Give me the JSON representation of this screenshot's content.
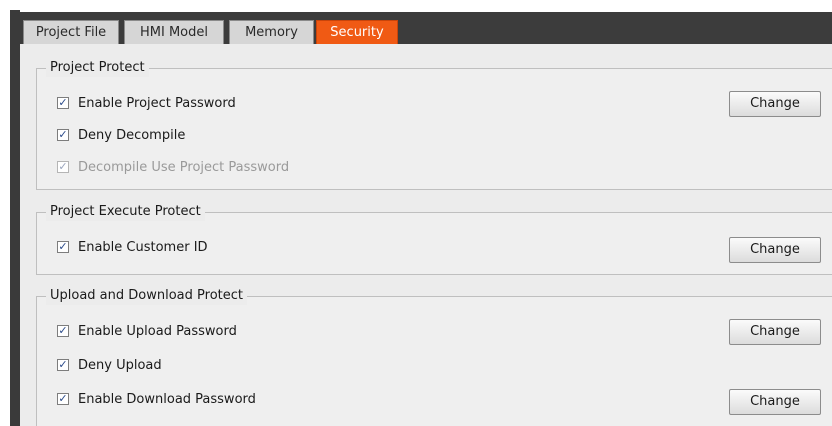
{
  "tabs": [
    {
      "label": "Project File"
    },
    {
      "label": "HMI Model"
    },
    {
      "label": "Memory"
    },
    {
      "label": "Security",
      "active": true
    }
  ],
  "colors": {
    "active_tab": "#f05a14",
    "tab_bar": "#3c3c3c",
    "panel": "#ececec"
  },
  "groups": {
    "project_protect": {
      "title": "Project Protect",
      "enable_project_password": {
        "label": "Enable Project Password",
        "checked": true
      },
      "deny_decompile": {
        "label": "Deny Decompile",
        "checked": true
      },
      "decompile_use_project_password": {
        "label": "Decompile Use Project Password",
        "checked": true,
        "disabled": true
      },
      "change_label": "Change"
    },
    "project_execute_protect": {
      "title": "Project Execute Protect",
      "enable_customer_id": {
        "label": "Enable Customer ID",
        "checked": true
      },
      "change_label": "Change"
    },
    "upload_download_protect": {
      "title": "Upload and Download Protect",
      "enable_upload_password": {
        "label": "Enable Upload Password",
        "checked": true
      },
      "deny_upload": {
        "label": "Deny Upload",
        "checked": true
      },
      "enable_download_password": {
        "label": "Enable Download Password",
        "checked": true
      },
      "upload_change_label": "Change",
      "download_change_label": "Change"
    }
  },
  "checkmark": "✓"
}
